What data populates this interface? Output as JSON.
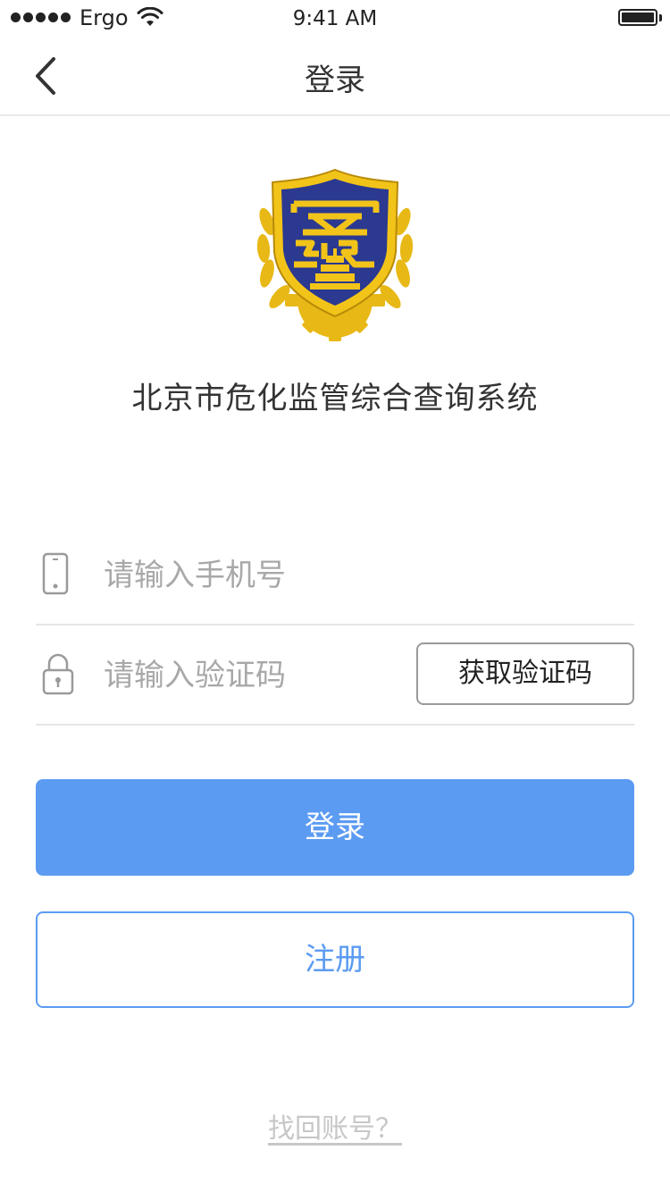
{
  "status_bar": {
    "carrier": "Ergo",
    "time": "9:41 AM"
  },
  "nav": {
    "title": "登录",
    "back_icon": "chevron-left-icon"
  },
  "app": {
    "name": "北京市危化监管综合查询系统",
    "logo": "emblem-logo"
  },
  "form": {
    "phone": {
      "icon": "phone-icon",
      "placeholder": "请输入手机号",
      "value": ""
    },
    "code": {
      "icon": "lock-icon",
      "placeholder": "请输入验证码",
      "value": "",
      "get_code_label": "获取验证码"
    }
  },
  "actions": {
    "login_label": "登录",
    "register_label": "注册",
    "recover_label": "找回账号？"
  },
  "colors": {
    "accent": "#5b9bf2",
    "placeholder": "#a8a8a8",
    "link_muted": "#c7c7c7",
    "emblem_gold": "#e8b816",
    "emblem_navy": "#2b3990"
  }
}
